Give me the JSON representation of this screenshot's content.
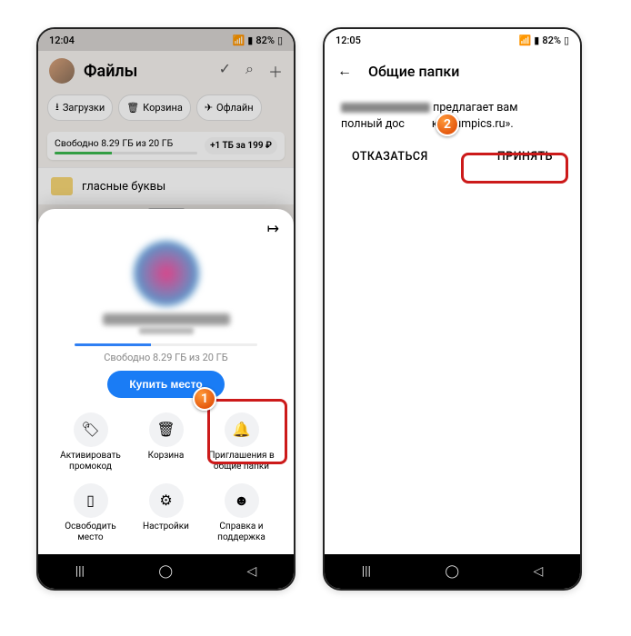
{
  "phone1": {
    "status": {
      "time": "12:04",
      "battery": "82%"
    },
    "header": {
      "title": "Файлы"
    },
    "chips": {
      "downloads": "Загрузки",
      "trash": "Корзина",
      "offline": "Офлайн"
    },
    "storage": {
      "free_text": "Свободно 8.29 ГБ из 20 ГБ",
      "offer": "+1 ТБ за 199 ₽"
    },
    "folder": {
      "name": "гласные буквы"
    },
    "sheet": {
      "storage_text": "Свободно 8.29 ГБ из 20 ГБ",
      "buy_label": "Купить место",
      "actions": {
        "promo": "Активировать промокод",
        "trash": "Корзина",
        "invites": "Приглашения в общие папки",
        "free_space": "Освободить место",
        "settings": "Настройки",
        "help": "Справка и поддержка"
      }
    },
    "marker1": "1"
  },
  "phone2": {
    "status": {
      "time": "12:05",
      "battery": "82%"
    },
    "header": {
      "title": "Общие папки"
    },
    "invite": {
      "line1_suffix": " предлагает вам",
      "line2_prefix": "полный дос",
      "line2_suffix": "ке «lumpics.ru».",
      "decline": "ОТКАЗАТЬСЯ",
      "accept": "ПРИНЯТЬ"
    },
    "marker2": "2"
  }
}
